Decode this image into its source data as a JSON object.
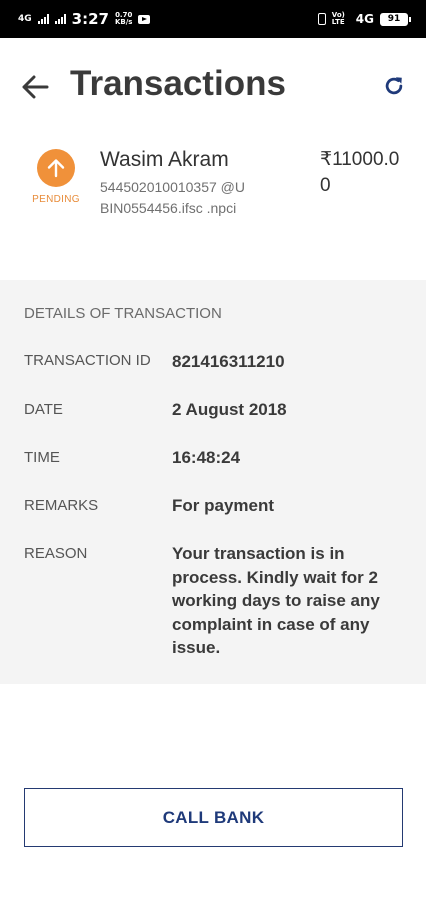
{
  "status_bar": {
    "network_left": "4G",
    "time": "3:27",
    "speed_value": "0.70",
    "speed_unit": "KB/s",
    "volte": "Vo) LTE",
    "network_right": "4G",
    "battery": "91"
  },
  "header": {
    "title": "Transactions"
  },
  "summary": {
    "status": "PENDING",
    "payee_name": "Wasim Akram",
    "payee_account": "544502010010357 @UBIN0554456.ifsc .npci",
    "amount": "₹11000.00"
  },
  "details": {
    "heading": "DETAILS OF TRANSACTION",
    "rows": [
      {
        "label": "TRANSACTION ID",
        "value": "821416311210"
      },
      {
        "label": "DATE",
        "value": "2 August 2018"
      },
      {
        "label": "TIME",
        "value": "16:48:24"
      },
      {
        "label": "REMARKS",
        "value": "For payment"
      },
      {
        "label": "REASON",
        "value": "Your transaction is in process. Kindly wait for 2 working days to raise any complaint in case of any issue."
      }
    ]
  },
  "actions": {
    "call_bank": "CALL BANK"
  },
  "colors": {
    "pending": "#f0913a",
    "accent": "#1f3a7a"
  },
  "icons": {
    "back": "arrow-left-icon",
    "refresh": "refresh-icon",
    "status": "arrow-up-icon"
  }
}
